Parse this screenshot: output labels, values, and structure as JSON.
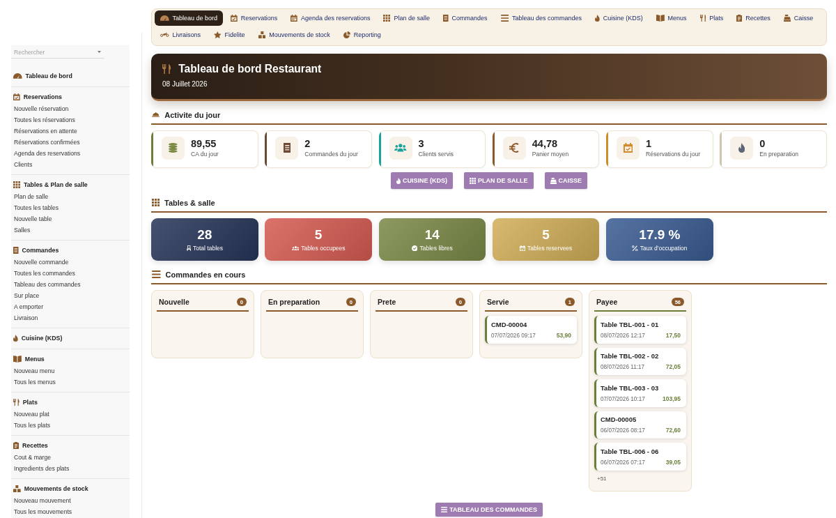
{
  "nav": {
    "tabs": [
      {
        "label": "Tableau de bord",
        "selected": true
      },
      {
        "label": "Reservations",
        "selected": false
      },
      {
        "label": "Agenda des reservations",
        "selected": false
      },
      {
        "label": "Plan de salle",
        "selected": false
      },
      {
        "label": "Commandes",
        "selected": false
      },
      {
        "label": "Tableau des commandes",
        "selected": false
      },
      {
        "label": "Cuisine (KDS)",
        "selected": false
      },
      {
        "label": "Menus",
        "selected": false
      },
      {
        "label": "Plats",
        "selected": false
      },
      {
        "label": "Recettes",
        "selected": false
      },
      {
        "label": "Caisse",
        "selected": false
      },
      {
        "label": "Livraisons",
        "selected": false
      },
      {
        "label": "Fidelite",
        "selected": false
      },
      {
        "label": "Mouvements de stock",
        "selected": false
      },
      {
        "label": "Reporting",
        "selected": false
      }
    ]
  },
  "sidebar": {
    "search": {
      "placeholder": "Rechercher"
    },
    "groups": [
      {
        "title": "Tableau de bord"
      },
      {
        "title": "Reservations",
        "items": [
          "Nouvelle réservation",
          "Toutes les réservations",
          "Réservations en attente",
          "Réservations confirmées",
          "Agenda des reservations",
          "Clients"
        ]
      },
      {
        "title": "Tables & Plan de salle",
        "items": [
          "Plan de salle",
          "Toutes les tables",
          "Nouvelle table",
          "Salles"
        ]
      },
      {
        "title": "Commandes",
        "items": [
          "Nouvelle commande",
          "Toutes les commandes",
          "Tableau des commandes",
          "Sur place",
          "A emporter",
          "Livraison"
        ]
      },
      {
        "title": "Cuisine (KDS)"
      },
      {
        "title": "Menus",
        "items": [
          "Nouveau menu",
          "Tous les menus"
        ]
      },
      {
        "title": "Plats",
        "items": [
          "Nouveau plat",
          "Tous les plats"
        ]
      },
      {
        "title": "Recettes",
        "items": [
          "Cout & marge",
          "Ingredients des plats"
        ]
      },
      {
        "title": "Mouvements de stock",
        "items": [
          "Nouveau mouvement",
          "Tous les mouvements"
        ]
      }
    ]
  },
  "header": {
    "title": "Tableau de bord Restaurant",
    "date": "08 Juillet 2026"
  },
  "activity": {
    "title": "Activite du jour",
    "stats": [
      {
        "value": "89,55",
        "label": "CA du jour",
        "color": "#6b7f3a"
      },
      {
        "value": "2",
        "label": "Commandes du jour",
        "color": "#6b4a33"
      },
      {
        "value": "3",
        "label": "Clients servis",
        "color": "#1aa39a"
      },
      {
        "value": "44,78",
        "label": "Panier moyen",
        "color": "#8b5a2b"
      },
      {
        "value": "1",
        "label": "Réservations du jour",
        "color": "#d08a2a"
      },
      {
        "value": "0",
        "label": "En preparation",
        "color": "#cfc6ae"
      }
    ],
    "actions": [
      {
        "label": "CUISINE (KDS)"
      },
      {
        "label": "PLAN DE SALLE"
      },
      {
        "label": "CAISSE"
      }
    ]
  },
  "tables": {
    "title": "Tables & salle",
    "stats": [
      {
        "value": "28",
        "label": "Total tables",
        "color": "#263659"
      },
      {
        "value": "5",
        "label": "Tables occupees",
        "color": "#d65c52"
      },
      {
        "value": "14",
        "label": "Tables libres",
        "color": "#7a8a48"
      },
      {
        "value": "5",
        "label": "Tables reservees",
        "color": "#d1ae58"
      },
      {
        "value": "17.9 %",
        "label": "Taux d'occupation",
        "color": "#3a5c92"
      }
    ]
  },
  "orders": {
    "title": "Commandes en cours",
    "columns": [
      {
        "title": "Nouvelle",
        "count": "0",
        "color": "#8b5a2b"
      },
      {
        "title": "En preparation",
        "count": "0",
        "color": "#8b5a2b"
      },
      {
        "title": "Prete",
        "count": "0",
        "color": "#8b5a2b"
      },
      {
        "title": "Servie",
        "count": "1",
        "color": "#8b5a2b",
        "cards": [
          {
            "title": "CMD-00004",
            "date": "07/07/2026 09:17",
            "amount": "53,90"
          }
        ]
      },
      {
        "title": "Payee",
        "count": "56",
        "color": "#6b7f3a",
        "cards": [
          {
            "title": "Table TBL-001 - 01",
            "date": "08/07/2026 12:17",
            "amount": "17,50"
          },
          {
            "title": "Table TBL-002 - 02",
            "date": "08/07/2026 11:17",
            "amount": "72,05"
          },
          {
            "title": "Table TBL-003 - 03",
            "date": "07/07/2026 10:17",
            "amount": "103,95"
          },
          {
            "title": "CMD-00005",
            "date": "06/07/2026 08:17",
            "amount": "72,60"
          },
          {
            "title": "Table TBL-006 - 06",
            "date": "06/07/2026 07:17",
            "amount": "39,05"
          }
        ],
        "more": "+51"
      }
    ],
    "action": {
      "label": "TABLEAU DES COMMANDES"
    }
  }
}
